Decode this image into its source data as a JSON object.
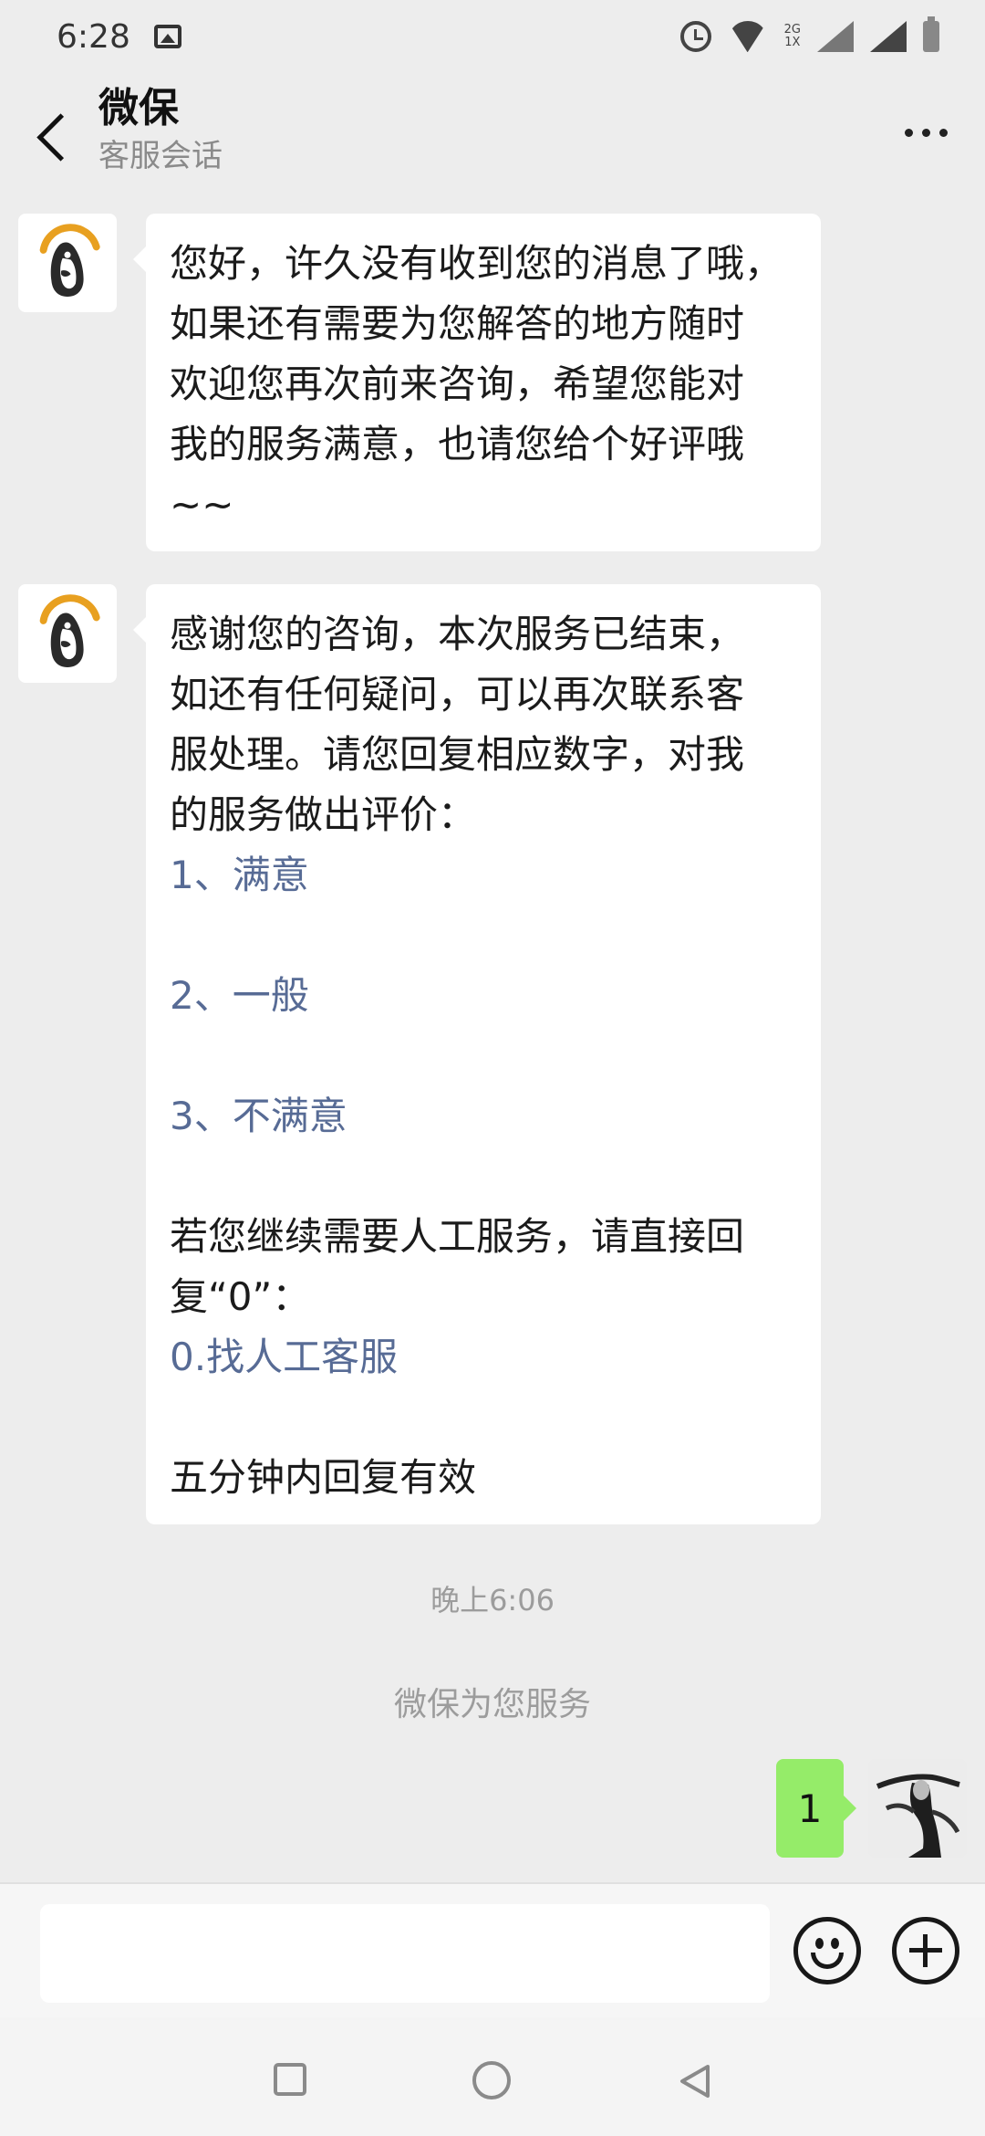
{
  "status_bar": {
    "time": "6:28",
    "icons": [
      "image-icon",
      "alarm-icon",
      "wifi-icon",
      "signal-icon",
      "battery-icon"
    ],
    "network_top": "2G",
    "network_bottom": "1X"
  },
  "header": {
    "title": "微保",
    "subtitle": "客服会话",
    "back_icon": "chevron-left-icon",
    "more_icon": "more-dots-icon"
  },
  "messages": [
    {
      "from": "service",
      "avatar_icon": "penguin-logo-icon",
      "lines": [
        "您好，许久没有收到您的消息了哦，",
        "如果还有需要为您解答的地方随时",
        "欢迎您再次前来咨询，希望您能对",
        "我的服务满意，也请您给个好评哦",
        "~~"
      ]
    },
    {
      "from": "service",
      "avatar_icon": "penguin-logo-icon",
      "lines": [
        "感谢您的咨询，本次服务已结束，",
        "如还有任何疑问，可以再次联系客",
        "服处理。请您回复相应数字，对我",
        "的服务做出评价："
      ],
      "options": [
        "1、满意",
        "2、一般",
        "3、不满意"
      ],
      "lines_after": [
        "若您继续需要人工服务，请直接回",
        "复“0”："
      ],
      "human_option": "0.找人工客服",
      "footer": "五分钟内回复有效"
    }
  ],
  "timestamp": "晚上6:06",
  "system_message": "微保为您服务",
  "my_message": {
    "text": "1"
  },
  "input_bar": {
    "value": "",
    "emoji_icon": "smiley-icon",
    "plus_icon": "plus-circle-icon"
  },
  "nav_bar": {
    "icons": [
      "recent-apps-icon",
      "home-icon",
      "back-icon"
    ]
  },
  "colors": {
    "background": "#ededed",
    "link": "#576b95",
    "my_bubble": "#95ec69",
    "muted": "#9c9c9c"
  }
}
